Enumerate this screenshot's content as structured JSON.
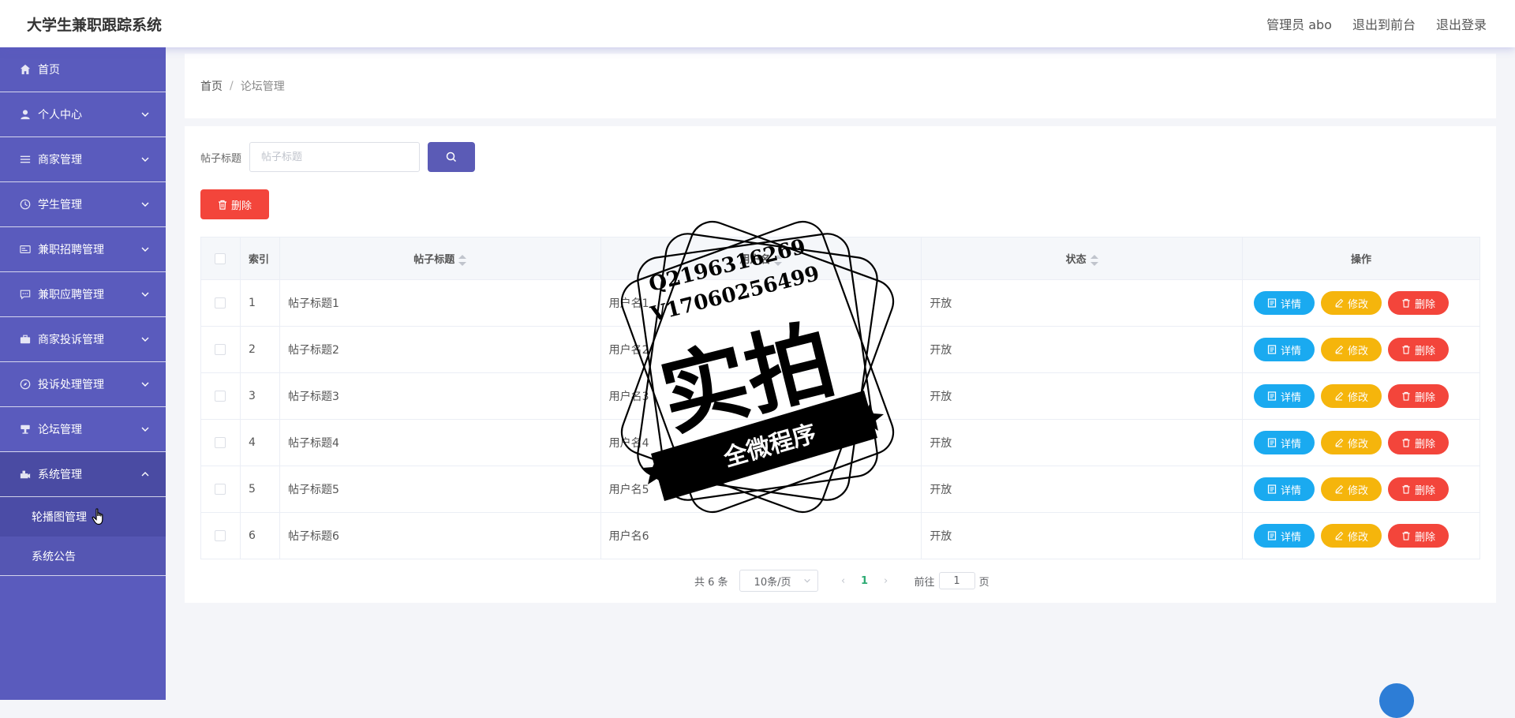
{
  "header": {
    "title": "大学生兼职跟踪系统",
    "user": "管理员 abo",
    "front_link": "退出到前台",
    "logout": "退出登录"
  },
  "sidebar": {
    "items": [
      {
        "label": "首页",
        "icon": "home-icon"
      },
      {
        "label": "个人中心",
        "icon": "user-icon"
      },
      {
        "label": "商家管理",
        "icon": "menu-icon"
      },
      {
        "label": "学生管理",
        "icon": "clock-icon"
      },
      {
        "label": "兼职招聘管理",
        "icon": "card-icon"
      },
      {
        "label": "兼职应聘管理",
        "icon": "chat-icon"
      },
      {
        "label": "商家投诉管理",
        "icon": "briefcase-icon"
      },
      {
        "label": "投诉处理管理",
        "icon": "compass-icon"
      },
      {
        "label": "论坛管理",
        "icon": "forum-icon"
      },
      {
        "label": "系统管理",
        "icon": "settings-icon"
      }
    ],
    "submenu": [
      "轮播图管理",
      "系统公告"
    ]
  },
  "breadcrumb": {
    "home": "首页",
    "separator": "/",
    "current": "论坛管理"
  },
  "search": {
    "label": "帖子标题",
    "placeholder": "帖子标题"
  },
  "toolbar": {
    "delete_label": "删除"
  },
  "table": {
    "headers": {
      "index": "索引",
      "title": "帖子标题",
      "user": "用户名",
      "status": "状态",
      "actions": "操作"
    },
    "rows": [
      {
        "index": "1",
        "title": "帖子标题1",
        "user": "用户名1",
        "status": "开放"
      },
      {
        "index": "2",
        "title": "帖子标题2",
        "user": "用户名2",
        "status": "开放"
      },
      {
        "index": "3",
        "title": "帖子标题3",
        "user": "用户名3",
        "status": "开放"
      },
      {
        "index": "4",
        "title": "帖子标题4",
        "user": "用户名4",
        "status": "开放"
      },
      {
        "index": "5",
        "title": "帖子标题5",
        "user": "用户名5",
        "status": "开放"
      },
      {
        "index": "6",
        "title": "帖子标题6",
        "user": "用户名6",
        "status": "开放"
      }
    ],
    "actions": {
      "detail": "详情",
      "edit": "修改",
      "delete": "删除"
    }
  },
  "pagination": {
    "total": "共 6 条",
    "page_size": "10条/页",
    "current": "1",
    "goto_prefix": "前往",
    "goto_value": "1",
    "goto_suffix": "页"
  },
  "watermark": {
    "line1": "Q2196316269",
    "line2": "V17060256499",
    "big": "实拍",
    "banner": "全微程序"
  },
  "colors": {
    "sidebar": "#5a5bbd",
    "primary": "#5b5bb6",
    "danger": "#f3453b",
    "info": "#1aaaf0",
    "warning": "#f5b50c"
  }
}
